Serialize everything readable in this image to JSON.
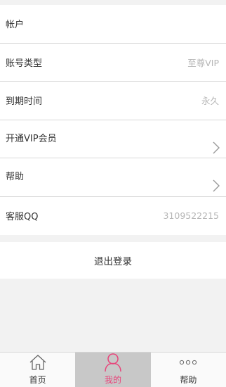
{
  "account": {
    "rows": [
      {
        "label": "帐户",
        "value": ""
      },
      {
        "label": "账号类型",
        "value": "至尊VIP"
      },
      {
        "label": "到期时间",
        "value": "永久"
      },
      {
        "label": "开通VIP会员",
        "value": ""
      },
      {
        "label": "帮助",
        "value": ""
      },
      {
        "label": "客服QQ",
        "value": "3109522215"
      }
    ]
  },
  "logout_label": "退出登录",
  "tabbar": {
    "tabs": [
      {
        "label": "首页",
        "icon": "home-icon"
      },
      {
        "label": "我的",
        "icon": "user-icon"
      },
      {
        "label": "帮助",
        "icon": "more-dots-icon"
      }
    ],
    "active_tab": "我的"
  },
  "colors": {
    "accent": "#e8447a",
    "value_text": "#b5b5b5",
    "active_tab_bg": "#c8c8c8"
  }
}
